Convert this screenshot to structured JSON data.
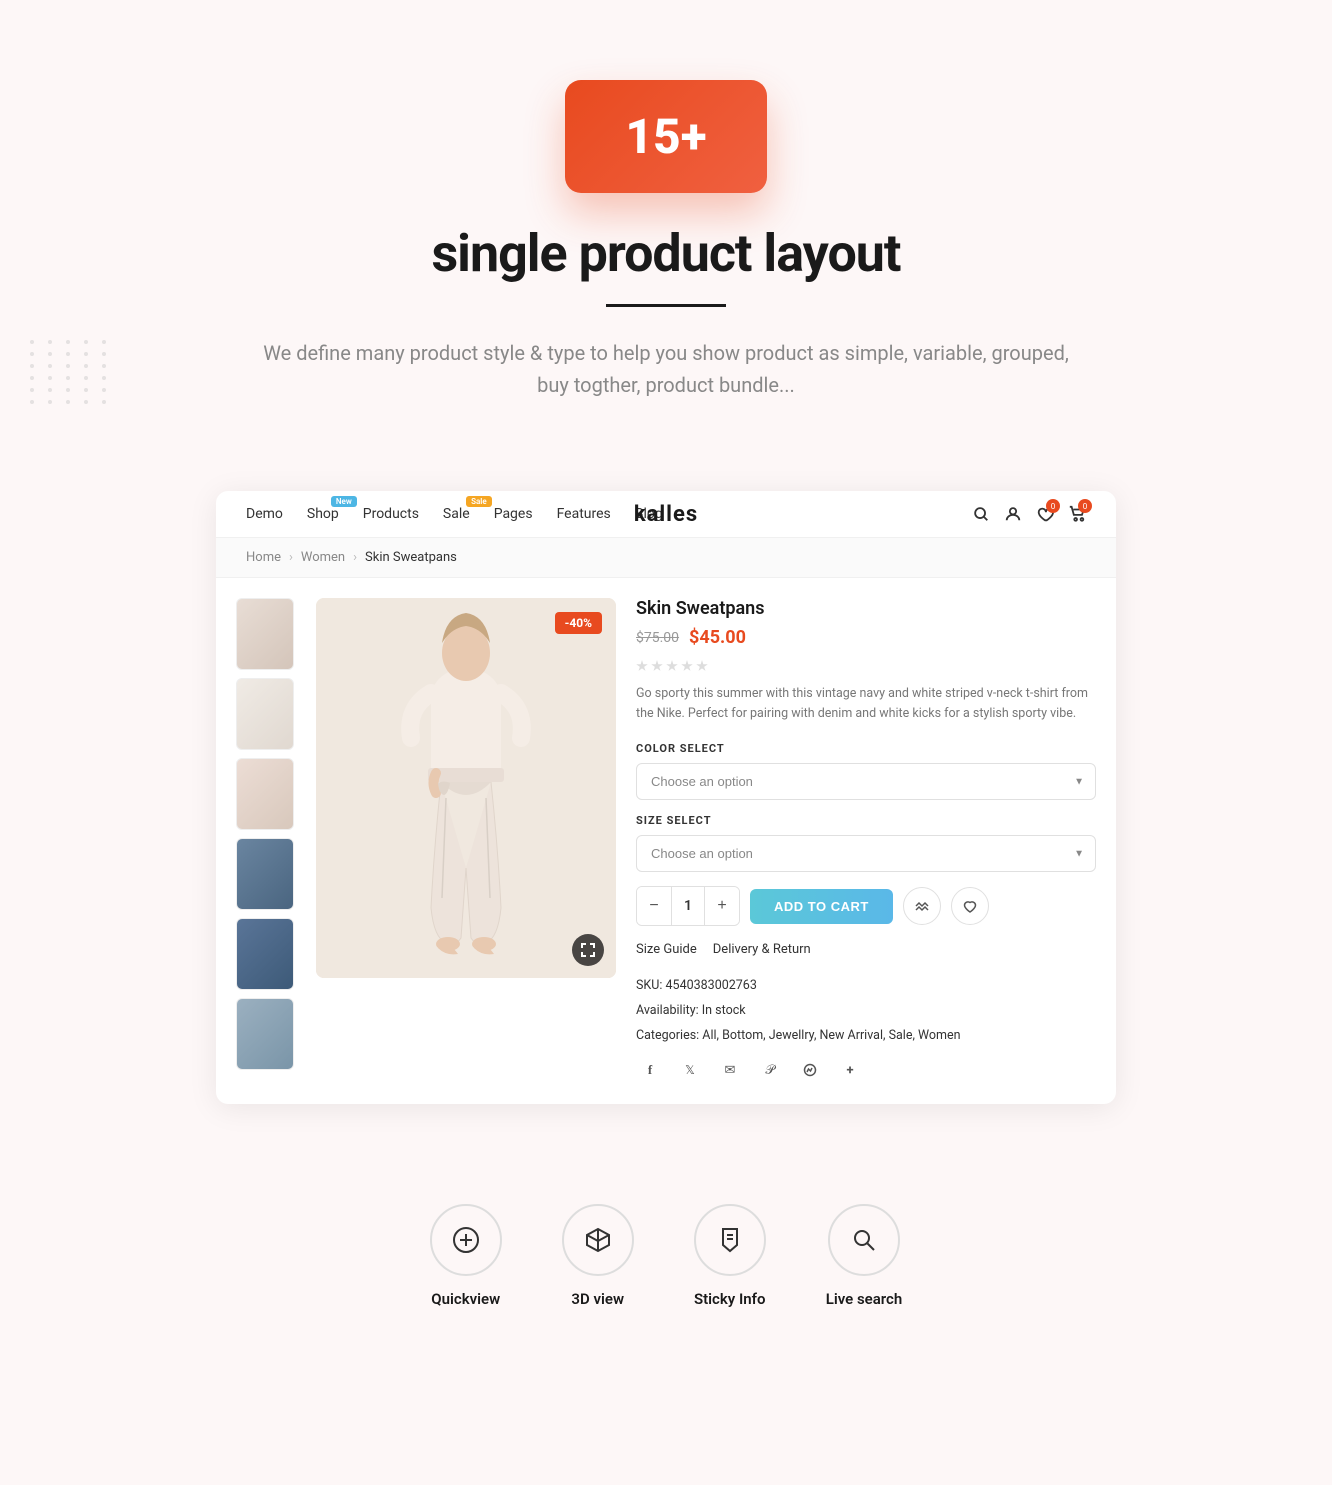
{
  "counter": {
    "value": "15+"
  },
  "hero": {
    "title": "single product layout",
    "description": "We define many product style & type to help you show product as simple, variable, grouped, buy togther, product bundle..."
  },
  "navbar": {
    "links": [
      {
        "label": "Demo",
        "badge": null
      },
      {
        "label": "Shop",
        "badge": "New"
      },
      {
        "label": "Products",
        "badge": null
      },
      {
        "label": "Sale",
        "badge": "Sale"
      },
      {
        "label": "Pages",
        "badge": null
      },
      {
        "label": "Features",
        "badge": null
      },
      {
        "label": "Blog",
        "badge": null
      }
    ],
    "brand": "kalles",
    "search_icon": "🔍",
    "user_icon": "👤",
    "wishlist_icon": "♡",
    "cart_icon": "🛒",
    "wishlist_count": "0",
    "cart_count": "0"
  },
  "breadcrumb": {
    "home": "Home",
    "category": "Women",
    "current": "Skin Sweatpans"
  },
  "product": {
    "name": "Skin Sweatpans",
    "price_original": "$75.00",
    "price_sale": "$45.00",
    "discount": "-40%",
    "description": "Go sporty this summer with this vintage navy and white striped v-neck t-shirt from the Nike. Perfect for pairing with denim and white kicks for a stylish sporty vibe.",
    "color_label": "COLOR SELECT",
    "color_placeholder": "Choose an option",
    "size_label": "SIZE SELECT",
    "size_placeholder": "Choose an option",
    "quantity": "1",
    "add_to_cart": "ADD TO CART",
    "size_guide": "Size Guide",
    "delivery_return": "Delivery & Return",
    "sku_label": "SKU:",
    "sku_value": "4540383002763",
    "availability_label": "Availability:",
    "availability_value": "In stock",
    "categories_label": "Categories:",
    "categories_value": "All, Bottom, Jewellry, New Arrival, Sale, Women",
    "thumbnails": [
      {
        "color": "thumb-1"
      },
      {
        "color": "thumb-2"
      },
      {
        "color": "thumb-3"
      },
      {
        "color": "thumb-4"
      },
      {
        "color": "thumb-5"
      },
      {
        "color": "thumb-6"
      }
    ]
  },
  "features": [
    {
      "icon": "⊕",
      "label": "Quickview",
      "name": "quickview"
    },
    {
      "icon": "⬡",
      "label": "3D view",
      "name": "3d-view"
    },
    {
      "icon": "🔖",
      "label": "Sticky Info",
      "name": "sticky-info"
    },
    {
      "icon": "🔍",
      "label": "Live search",
      "name": "live-search"
    }
  ],
  "share_icons": [
    "f",
    "t",
    "✉",
    "p",
    "m",
    "+"
  ]
}
